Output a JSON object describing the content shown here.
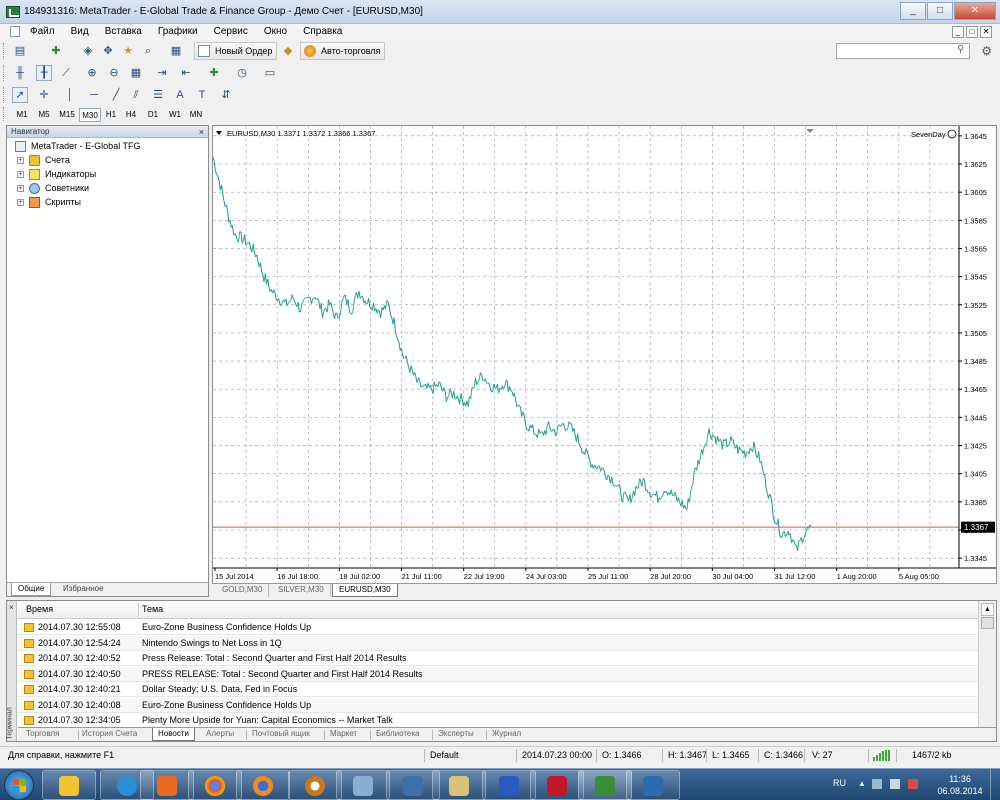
{
  "window": {
    "title": "184931316: MetaTrader - E-Global Trade & Finance Group - Демо Счет - [EURUSD,M30]",
    "buttons": [
      "_",
      "□",
      "✕"
    ]
  },
  "menu": {
    "items": [
      "Файл",
      "Вид",
      "Вставка",
      "Графики",
      "Сервис",
      "Окно",
      "Справка"
    ],
    "mdi_buttons": [
      "_",
      "□",
      "✕"
    ]
  },
  "toolbar": {
    "new_order_label": "Новый Ордер",
    "autotrading_label": "Авто-торговля",
    "search_placeholder": "",
    "timeframes": [
      "M1",
      "M5",
      "M15",
      "M30",
      "H1",
      "H4",
      "D1",
      "W1",
      "MN"
    ],
    "active_timeframe": "M30"
  },
  "navigator": {
    "title": "Навигатор",
    "close": "×",
    "root": "MetaTrader - E-Global TFG",
    "items": [
      {
        "label": "Счета",
        "icon": "accounts-icon"
      },
      {
        "label": "Индикаторы",
        "icon": "indicators-icon"
      },
      {
        "label": "Советники",
        "icon": "experts-icon"
      },
      {
        "label": "Скрипты",
        "icon": "scripts-icon"
      }
    ],
    "tabs": [
      "Общие",
      "Избранное"
    ],
    "active_tab": "Общие"
  },
  "chart": {
    "header": "EURUSD,M30  1.3371 1.3372 1.3366 1.3367",
    "indicator_label": "SevenDay",
    "current_price": "1.3367",
    "tabs": [
      "GOLD,M30",
      "SILVER,M30",
      "EURUSD,M30"
    ],
    "active_tab": "EURUSD,M30",
    "colors": {
      "line": "#1a93a8",
      "line_up": "#2bb673",
      "current_price_line": "#d9534f",
      "grid": "#c8c8c8"
    }
  },
  "chart_data": {
    "type": "line",
    "title": "EURUSD,M30",
    "x_tick_labels": [
      "15 Jul 2014",
      "16 Jul 18:00",
      "18 Jul 02:00",
      "21 Jul 11:00",
      "22 Jul 19:00",
      "24 Jul 03:00",
      "25 Jul 11:00",
      "28 Jul 20:00",
      "30 Jul 04:00",
      "31 Jul 12:00",
      "1 Aug 20:00",
      "5 Aug 05:00"
    ],
    "y_tick_labels": [
      "1.3645",
      "1.3625",
      "1.3605",
      "1.3585",
      "1.3565",
      "1.3545",
      "1.3525",
      "1.3505",
      "1.3485",
      "1.3465",
      "1.3445",
      "1.3425",
      "1.3405",
      "1.3385",
      "1.3365",
      "1.3345"
    ],
    "ylim": [
      1.3338,
      1.3652
    ],
    "current_price": 1.3367,
    "grid": true,
    "series": [
      {
        "values": [
          1.363,
          1.361,
          1.359,
          1.3575,
          1.3572,
          1.3568,
          1.356,
          1.3545,
          1.3535,
          1.353,
          1.3525,
          1.353,
          1.3522,
          1.3528,
          1.3532,
          1.352,
          1.3525,
          1.3515,
          1.353,
          1.3522,
          1.3535,
          1.3528,
          1.3525,
          1.352,
          1.3525,
          1.351,
          1.349,
          1.348,
          1.347,
          1.3465,
          1.3465,
          1.3468,
          1.346,
          1.3462,
          1.3458,
          1.3455,
          1.347,
          1.3475,
          1.3468,
          1.3465,
          1.347,
          1.3465,
          1.345,
          1.344,
          1.3435,
          1.3432,
          1.3438,
          1.3435,
          1.344,
          1.3438,
          1.343,
          1.342,
          1.3412,
          1.341,
          1.3405,
          1.34,
          1.339,
          1.3385,
          1.3395,
          1.34,
          1.3392,
          1.3388,
          1.3395,
          1.339,
          1.3385,
          1.338,
          1.3405,
          1.342,
          1.3435,
          1.343,
          1.3425,
          1.3428,
          1.3422,
          1.342,
          1.3425,
          1.3415,
          1.3395,
          1.3375,
          1.3362,
          1.3365,
          1.335,
          1.3362,
          1.3367
        ]
      }
    ]
  },
  "terminal": {
    "side_label": "Терминал",
    "close": "×",
    "columns": [
      "Время",
      "Тема"
    ],
    "rows": [
      {
        "time": "2014.07.30 12:55:08",
        "subject": "Euro-Zone Business Confidence Holds Up"
      },
      {
        "time": "2014.07.30 12:54:24",
        "subject": "Nintendo Swings to Net Loss in 1Q"
      },
      {
        "time": "2014.07.30 12:40:52",
        "subject": "Press Release: Total : Second Quarter and First Half 2014 Results"
      },
      {
        "time": "2014.07.30 12:40:50",
        "subject": "PRESS RELEASE: Total : Second Quarter and First Half 2014 Results"
      },
      {
        "time": "2014.07.30 12:40:21",
        "subject": "Dollar Steady; U.S. Data, Fed in Focus"
      },
      {
        "time": "2014.07.30 12:40:08",
        "subject": "Euro-Zone Business Confidence Holds Up"
      },
      {
        "time": "2014.07.30 12:34:05",
        "subject": "Plenty More Upside for Yuan: Capital Economics -- Market Talk"
      }
    ],
    "tabs": [
      "Торговля",
      "История Счета",
      "Новости",
      "Алерты",
      "Почтовый ящик",
      "Маркет",
      "Библиотека",
      "Эксперты",
      "Журнал"
    ],
    "active_tab": "Новости"
  },
  "statusbar": {
    "help": "Для справки, нажмите F1",
    "profile": "Default",
    "datetime": "2014.07.23 00:00",
    "open": "O: 1.3466",
    "high": "H: 1.3467",
    "low": "L: 1.3465",
    "close": "C: 1.3466",
    "volume": "V: 27",
    "traffic": "1467/2 kb"
  },
  "taskbar": {
    "apps": [
      "windows-explorer",
      "internet-explorer",
      "media-player",
      "chrome",
      "firefox",
      "torrent-client",
      "windows-explorer-folder",
      "metaeditor",
      "archiver",
      "terminal-app",
      "metatrader-app",
      "trading-platform"
    ],
    "lang": "RU",
    "time": "11:36",
    "date": "06.08.2014"
  }
}
